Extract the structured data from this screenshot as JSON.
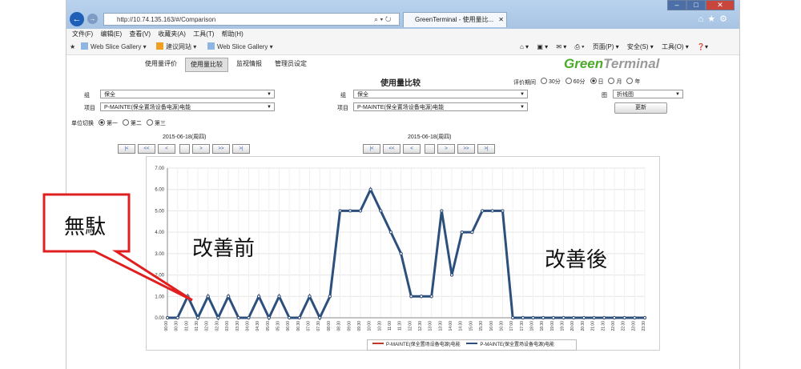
{
  "browser": {
    "url": "http://10.74.135.163/#/Comparison",
    "tab_title": "GreenTerminal - 使用量比...",
    "menu": [
      "文件(F)",
      "编辑(E)",
      "查看(V)",
      "收藏夹(A)",
      "工具(T)",
      "帮助(H)"
    ],
    "favorites": [
      "Web Slice Gallery ▾",
      "建议网站 ▾",
      "Web Slice Gallery ▾"
    ],
    "commands": [
      "页面(P) ▾",
      "安全(S) ▾",
      "工具(O) ▾"
    ],
    "colors": {
      "titlebar": "#b9d3ee",
      "back_button": "#1e5fb8"
    }
  },
  "app": {
    "tabs": [
      "使用量评价",
      "使用量比较",
      "监视情报",
      "管理员设定"
    ],
    "active_tab": "使用量比较",
    "logo": {
      "part1": "Green",
      "part2": "Terminal",
      "color": "#4caa2a"
    },
    "page_title": "使用量比较",
    "period_label": "评价期间",
    "period_options": [
      "30分",
      "60分",
      "日",
      "月",
      "年"
    ],
    "period_selected": "日",
    "left": {
      "group_label": "组",
      "group_value": "保全",
      "item_label": "项目",
      "item_value": "P-MAINTE(保全置场设备电源)电能"
    },
    "right": {
      "group_label": "组",
      "group_value": "保全",
      "item_label": "项目",
      "item_value": "P-MAINTE(保全置场设备电源)电能"
    },
    "chart_label": "图",
    "chart_type_value": "折线图",
    "update_button": "更新",
    "unit_label": "单位切换",
    "unit_options": [
      "第一",
      "第二",
      "第三"
    ],
    "unit_selected": "第一",
    "left_date": "2015-06-18(周四)",
    "right_date": "2015-06-18(周四)",
    "pager_buttons": [
      "|<",
      "<<",
      "<",
      "",
      ">",
      ">>",
      ">|"
    ]
  },
  "overlays": {
    "callout_text": "無駄",
    "before_label": "改善前",
    "after_label": "改善後",
    "callout_color": "#e02020"
  },
  "chart_data": {
    "type": "line",
    "title": "",
    "xlabel": "",
    "ylabel": "",
    "ylim": [
      0,
      7
    ],
    "yticks": [
      "0.00",
      "1.00",
      "2.00",
      "3.00",
      "4.00",
      "5.00",
      "6.00",
      "7.00"
    ],
    "grid": true,
    "legend_placement": "bottom-right",
    "categories": [
      "00:00",
      "00:30",
      "01:00",
      "01:30",
      "02:00",
      "02:30",
      "03:00",
      "03:30",
      "04:00",
      "04:30",
      "05:00",
      "05:30",
      "06:00",
      "06:30",
      "07:00",
      "07:30",
      "08:00",
      "08:30",
      "09:00",
      "09:30",
      "10:00",
      "10:30",
      "11:00",
      "11:30",
      "12:00",
      "12:30",
      "13:00",
      "13:30",
      "14:00",
      "14:30",
      "15:00",
      "15:30",
      "16:00",
      "16:30",
      "17:00",
      "17:30",
      "18:00",
      "18:30",
      "19:00",
      "19:30",
      "20:00",
      "20:30",
      "21:00",
      "21:30",
      "22:00",
      "22:30",
      "23:00",
      "23:30"
    ],
    "series": [
      {
        "name": "P-MAINTE(保全置场设备电源)电能",
        "color": "#c0392b",
        "values": [
          0,
          0,
          1,
          0,
          1,
          0,
          1,
          0,
          0,
          1,
          0,
          1,
          0,
          0,
          1,
          0,
          1,
          5,
          5,
          5,
          6,
          5,
          4,
          3,
          1,
          1,
          1,
          5,
          2,
          4,
          4,
          5,
          5,
          5,
          0,
          0,
          0,
          0,
          0,
          0,
          0,
          0,
          0,
          0,
          0,
          0,
          0,
          0
        ]
      },
      {
        "name": "P-MAINTE(保全置场设备电源)电能",
        "color": "#2c4f7c",
        "values": [
          0,
          0,
          1,
          0,
          1,
          0,
          1,
          0,
          0,
          1,
          0,
          1,
          0,
          0,
          1,
          0,
          1,
          5,
          5,
          5,
          6,
          5,
          4,
          3,
          1,
          1,
          1,
          5,
          2,
          4,
          4,
          5,
          5,
          5,
          0,
          0,
          0,
          0,
          0,
          0,
          0,
          0,
          0,
          0,
          0,
          0,
          0,
          0
        ]
      }
    ]
  }
}
